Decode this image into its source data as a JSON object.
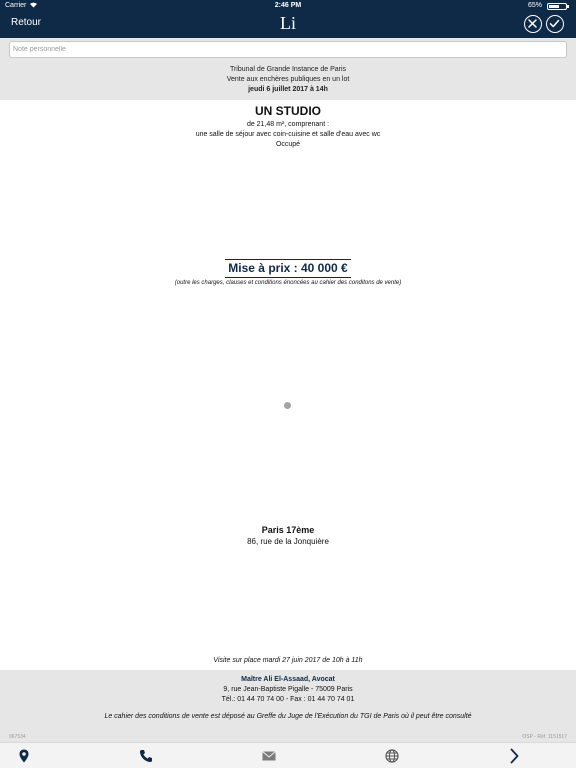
{
  "status_bar": {
    "carrier": "Carrier",
    "time": "2:46 PM",
    "battery_percent": "65%",
    "battery_level": 0.65,
    "wifi_icon": "wifi-icon"
  },
  "header": {
    "back_label": "Retour",
    "logo": "Li",
    "close_icon": "close-circle-icon",
    "confirm_icon": "check-circle-icon",
    "background": "#0e2a47"
  },
  "note": {
    "placeholder": "Note personnelle",
    "value": ""
  },
  "auction": {
    "court": "Tribunal de Grande Instance de Paris",
    "sale_type": "Vente aux enchères publiques en un lot",
    "date": "jeudi 6 juillet 2017 à 14h"
  },
  "property": {
    "title": "UN STUDIO",
    "description": [
      "de 21,48 m², comprenant :",
      "une salle de séjour avec coin-cuisine et salle d'eau avec wc",
      "Occupé"
    ],
    "price": "Mise à prix : 40 000 €",
    "price_note": "(outre les charges, clauses et conditions énoncées au cahier des conditons de vente)",
    "city": "Paris 17ème",
    "address": "86, rue de la Jonquière",
    "visit": "Visite sur place mardi 27 juin 2017 de 10h à 11h"
  },
  "lawyer": {
    "name": "Maître Ali El-Assaad, Avocat",
    "address": "9, rue Jean-Baptiste Pigalle - 75009 Paris",
    "contact": "Tél.: 01 44 70 74 00 - Fax : 01 44 70 74 01",
    "conditions": "Le cahier des conditions de vente est déposé au Greffe du Juge de l'Exécution du TGI de Paris où il peut être consulté"
  },
  "refs": {
    "left": "067534",
    "right": "OSP - Réf. 1151517"
  },
  "toolbar": {
    "items": [
      "location-pin-icon",
      "phone-icon",
      "envelope-icon",
      "globe-icon",
      "chevron-right-icon"
    ]
  },
  "colors": {
    "brand": "#0e2a47",
    "band": "#e6e6e6",
    "muted": "#9a9a9a"
  }
}
